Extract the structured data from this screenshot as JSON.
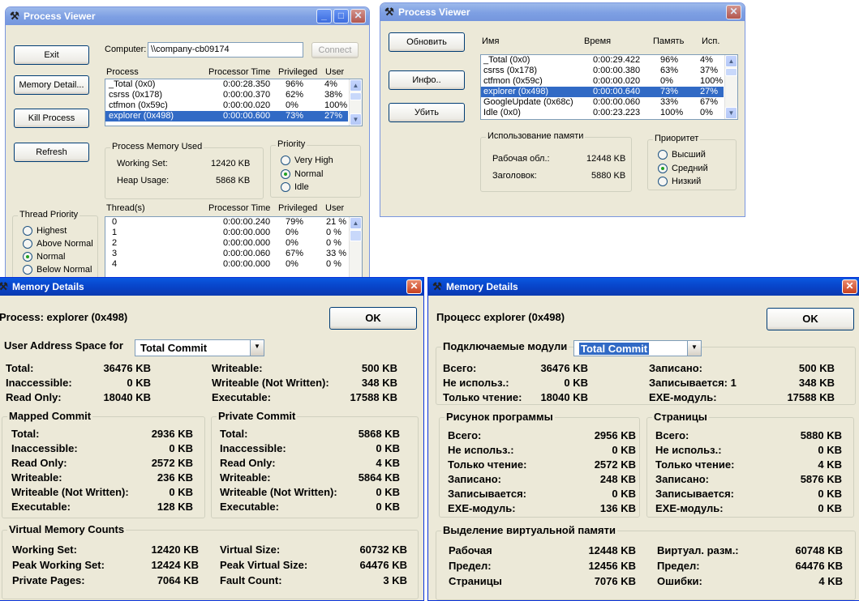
{
  "pv_en": {
    "title": "Process Viewer",
    "buttons": {
      "exit": "Exit",
      "memory": "Memory Detail...",
      "kill": "Kill Process",
      "refresh": "Refresh"
    },
    "computer_label": "Computer:",
    "computer_value": "\\\\company-cb09174",
    "connect": "Connect",
    "proc_headers": [
      "Process",
      "Processor Time",
      "Privileged",
      "User"
    ],
    "processes": [
      [
        "_Total (0x0)",
        "0:00:28.350",
        "96%",
        "4%"
      ],
      [
        "csrss (0x178)",
        "0:00:00.370",
        "62%",
        "38%"
      ],
      [
        "ctfmon (0x59c)",
        "0:00:00.020",
        "0%",
        "100%"
      ],
      [
        "explorer (0x498)",
        "0:00:00.600",
        "73%",
        "27%"
      ]
    ],
    "pmu_title": "Process Memory Used",
    "working_set_label": "Working Set:",
    "working_set": "12420 KB",
    "heap_label": "Heap Usage:",
    "heap": "5868 KB",
    "priority_title": "Priority",
    "priority": [
      "Very High",
      "Normal",
      "Idle"
    ],
    "thread_priority_title": "Thread Priority",
    "thread_priority": [
      "Highest",
      "Above Normal",
      "Normal",
      "Below Normal"
    ],
    "thread_headers": [
      "Thread(s)",
      "Processor Time",
      "Privileged",
      "User"
    ],
    "threads": [
      [
        "0",
        "0:00:00.240",
        "79%",
        "21 %"
      ],
      [
        "1",
        "0:00:00.000",
        "0%",
        "0 %"
      ],
      [
        "2",
        "0:00:00.000",
        "0%",
        "0 %"
      ],
      [
        "3",
        "0:00:00.060",
        "67%",
        "33 %"
      ],
      [
        "4",
        "0:00:00.000",
        "0%",
        "0 %"
      ]
    ]
  },
  "pv_ru": {
    "title": "Process Viewer",
    "buttons": {
      "refresh": "Обновить",
      "info": "Инфо..",
      "kill": "Убить"
    },
    "proc_headers": [
      "Имя",
      "Время",
      "Память",
      "Исп."
    ],
    "processes": [
      [
        "_Total (0x0)",
        "0:00:29.422",
        "96%",
        "4%"
      ],
      [
        "csrss (0x178)",
        "0:00:00.380",
        "63%",
        "37%"
      ],
      [
        "ctfmon (0x59c)",
        "0:00:00.020",
        "0%",
        "100%"
      ],
      [
        "explorer (0x498)",
        "0:00:00.640",
        "73%",
        "27%"
      ],
      [
        "GoogleUpdate (0x68c)",
        "0:00:00.060",
        "33%",
        "67%"
      ],
      [
        "Idle (0x0)",
        "0:00:23.223",
        "100%",
        "0%"
      ]
    ],
    "mem_title": "Использование памяти",
    "ws_label": "Рабочая обл.:",
    "ws": "12448 KB",
    "hdr_label": "Заголовок:",
    "hdr": "5880 KB",
    "priority_title": "Приоритет",
    "priority": [
      "Высший",
      "Средний",
      "Низкий"
    ]
  },
  "md_en": {
    "title": "Memory Details",
    "process_label": "Process:  explorer (0x498)",
    "ok": "OK",
    "uas_label": "User Address Space for",
    "combo": "Total Commit",
    "top": [
      [
        "Total:",
        "36476 KB",
        "Writeable:",
        "500 KB"
      ],
      [
        "Inaccessible:",
        "0 KB",
        "Writeable (Not Written):",
        "348 KB"
      ],
      [
        "Read Only:",
        "18040 KB",
        "Executable:",
        "17588 KB"
      ]
    ],
    "mapped_title": "Mapped Commit",
    "mapped": [
      [
        "Total:",
        "2936 KB"
      ],
      [
        "Inaccessible:",
        "0 KB"
      ],
      [
        "Read Only:",
        "2572 KB"
      ],
      [
        "Writeable:",
        "236 KB"
      ],
      [
        "Writeable (Not Written):",
        "0 KB"
      ],
      [
        "Executable:",
        "128 KB"
      ]
    ],
    "private_title": "Private Commit",
    "private": [
      [
        "Total:",
        "5868 KB"
      ],
      [
        "Inaccessible:",
        "0 KB"
      ],
      [
        "Read Only:",
        "4 KB"
      ],
      [
        "Writeable:",
        "5864 KB"
      ],
      [
        "Writeable (Not Written):",
        "0 KB"
      ],
      [
        "Executable:",
        "0 KB"
      ]
    ],
    "vm_title": "Virtual Memory Counts",
    "vm": [
      [
        "Working Set:",
        "12420 KB",
        "Virtual Size:",
        "60732 KB"
      ],
      [
        "Peak Working Set:",
        "12424 KB",
        "Peak Virtual Size:",
        "64476 KB"
      ],
      [
        "Private Pages:",
        "7064 KB",
        "Fault Count:",
        "3 KB"
      ]
    ]
  },
  "md_ru": {
    "title": "Memory Details",
    "process_label": "Процесс  explorer (0x498)",
    "ok": "OK",
    "uas_label": "Подключаемые модули",
    "combo": "Total Commit",
    "top": [
      [
        "Всего:",
        "36476 KB",
        "Записано:",
        "500 KB"
      ],
      [
        "Не использ.:",
        "0 KB",
        "Записывается: 1",
        "348 KB"
      ],
      [
        "Только чтение:",
        "18040 KB",
        "EXE-модуль:",
        "17588 KB"
      ]
    ],
    "mapped_title": "Рисунок программы",
    "mapped": [
      [
        "Всего:",
        "2956 KB"
      ],
      [
        "Не использ.:",
        "0 KB"
      ],
      [
        "Только чтение:",
        "2572 KB"
      ],
      [
        "Записано:",
        "248 KB"
      ],
      [
        "Записывается:",
        "0 KB"
      ],
      [
        "EXE-модуль:",
        "136 KB"
      ]
    ],
    "private_title": "Страницы",
    "private": [
      [
        "Всего:",
        "5880 KB"
      ],
      [
        "Не использ.:",
        "0 KB"
      ],
      [
        "Только чтение:",
        "4 KB"
      ],
      [
        "Записано:",
        "5876 KB"
      ],
      [
        "Записывается:",
        "0 KB"
      ],
      [
        "EXE-модуль:",
        "0 KB"
      ]
    ],
    "vm_title": "Выделение виртуальной памяти",
    "vm": [
      [
        "Рабочая",
        "12448 KB",
        "Виртуал. разм.:",
        "60748 KB"
      ],
      [
        "Предел:",
        "12456 KB",
        "Предел:",
        "64476 KB"
      ],
      [
        "Страницы",
        "7076 KB",
        "Ошибки:",
        "4 KB"
      ]
    ]
  }
}
